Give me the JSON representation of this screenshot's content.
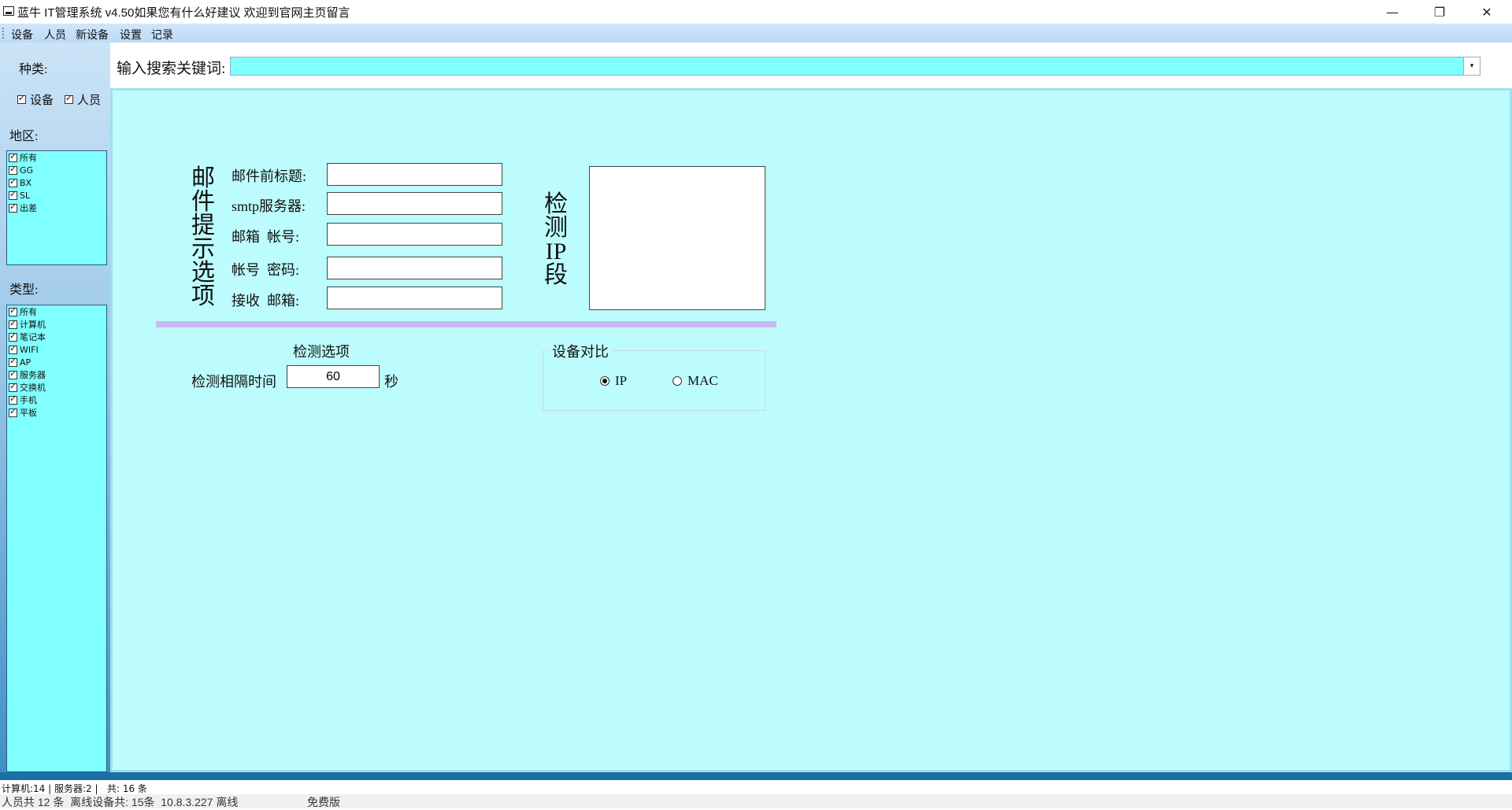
{
  "window": {
    "title": "蓝牛 IT管理系统  v4.50如果您有什么好建议 欢迎到官网主页留言",
    "minimize": "—",
    "restore": "❐",
    "close": "✕"
  },
  "menu": [
    "设备",
    "人员",
    "新设备",
    "设置",
    "记录"
  ],
  "sidebar": {
    "category_label": "种类:",
    "category_checks": [
      {
        "label": "设备",
        "checked": true
      },
      {
        "label": "人员",
        "checked": true
      }
    ],
    "region_label": "地区:",
    "regions": [
      {
        "label": "所有",
        "checked": true
      },
      {
        "label": "GG",
        "checked": true
      },
      {
        "label": "BX",
        "checked": true
      },
      {
        "label": "SL",
        "checked": true
      },
      {
        "label": "出差",
        "checked": true
      }
    ],
    "type_label": "类型:",
    "types": [
      {
        "label": "所有",
        "checked": true
      },
      {
        "label": "计算机",
        "checked": true
      },
      {
        "label": "笔记本",
        "checked": true
      },
      {
        "label": "WIFI",
        "checked": true
      },
      {
        "label": "AP",
        "checked": true
      },
      {
        "label": "服务器",
        "checked": true
      },
      {
        "label": "交换机",
        "checked": true
      },
      {
        "label": "手机",
        "checked": true
      },
      {
        "label": "平板",
        "checked": true
      }
    ]
  },
  "search": {
    "label": "输入搜索关键词:",
    "value": "",
    "dropdown_icon": "▾"
  },
  "email_section": {
    "vertical_title": [
      "邮",
      "件",
      "提",
      "示",
      "选",
      "项"
    ],
    "fields": [
      {
        "label": "邮件前标题:",
        "value": ""
      },
      {
        "label": "smtp服务器:",
        "value": ""
      },
      {
        "label": "邮箱  帐号:",
        "value": ""
      },
      {
        "label": "帐号  密码:",
        "value": ""
      },
      {
        "label": "接收  邮箱:",
        "value": ""
      }
    ]
  },
  "ip_section": {
    "vertical_title": [
      "检",
      "测",
      "IP",
      "段"
    ],
    "value": ""
  },
  "detect_options": {
    "title": "检测选项",
    "interval_label": "检测相隔时间",
    "interval_value": "60",
    "unit": "秒"
  },
  "device_compare": {
    "title": "设备对比",
    "options": [
      {
        "label": "IP",
        "selected": true
      },
      {
        "label": "MAC",
        "selected": false
      }
    ]
  },
  "status": {
    "line1": "计算机:14 | 服务器:2 |   共: 16 条",
    "line2_left": "人员共 12 条  离线设备共: 15条  10.8.3.227 离线",
    "line2_right": "免费版"
  }
}
